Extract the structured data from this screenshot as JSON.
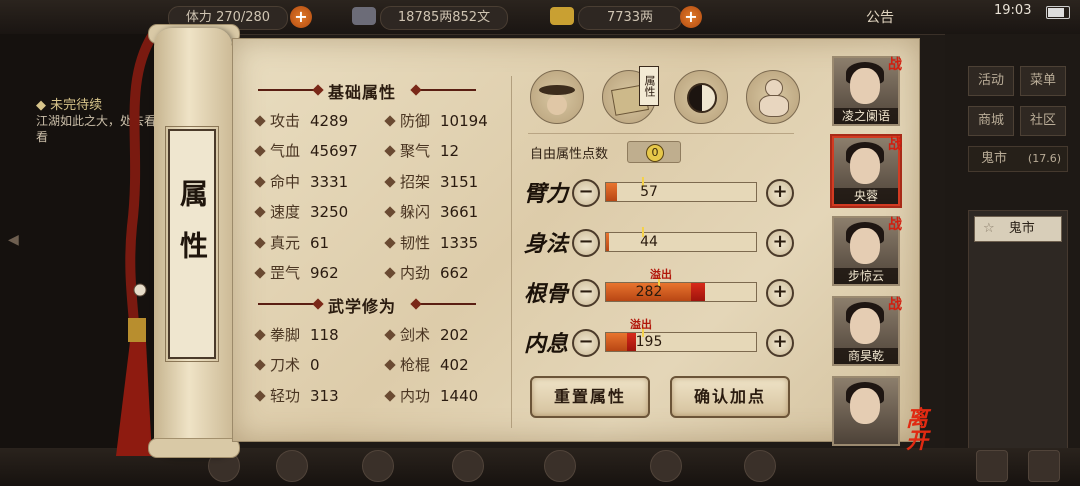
{
  "topbar": {
    "stamina_label": "体力",
    "stamina": "270/280",
    "silver": "18785两852文",
    "gold": "7733两",
    "announcement": "公告",
    "time": "19:03"
  },
  "quest": {
    "title": "未完待续",
    "desc": "江湖如此之大，处去看看"
  },
  "right_menu": [
    "活动",
    "菜单",
    "商城",
    "社区"
  ],
  "right_location": {
    "name": "鬼市",
    "level": "(17.6)"
  },
  "right_search": "鬼市",
  "scroll_title": "属性",
  "base_section": "基础属性",
  "base_stats": [
    {
      "name": "攻击",
      "value": "4289"
    },
    {
      "name": "防御",
      "value": "10194"
    },
    {
      "name": "气血",
      "value": "45697"
    },
    {
      "name": "聚气",
      "value": "12"
    },
    {
      "name": "命中",
      "value": "3331"
    },
    {
      "name": "招架",
      "value": "3151"
    },
    {
      "name": "速度",
      "value": "3250"
    },
    {
      "name": "躲闪",
      "value": "3661"
    },
    {
      "name": "真元",
      "value": "61"
    },
    {
      "name": "韧性",
      "value": "1335"
    },
    {
      "name": "罡气",
      "value": "962"
    },
    {
      "name": "内劲",
      "value": "662"
    }
  ],
  "martial_section": "武学修为",
  "martial_stats": [
    {
      "name": "拳脚",
      "value": "118"
    },
    {
      "name": "剑术",
      "value": "202"
    },
    {
      "name": "刀术",
      "value": "0"
    },
    {
      "name": "枪棍",
      "value": "402"
    },
    {
      "name": "轻功",
      "value": "313"
    },
    {
      "name": "内功",
      "value": "1440"
    }
  ],
  "tabs": {
    "badge": "属性"
  },
  "free_points_label": "自由属性点数",
  "free_points": "0",
  "attributes": [
    {
      "label": "臂力",
      "value": "57",
      "fill": 0.07,
      "overflow": 0,
      "overflow_label": ""
    },
    {
      "label": "身法",
      "value": "44",
      "fill": 0.02,
      "overflow": 0,
      "overflow_label": ""
    },
    {
      "label": "根骨",
      "value": "282",
      "fill": 0.57,
      "overflow": 0.09,
      "overflow_label": "溢出"
    },
    {
      "label": "内息",
      "value": "195",
      "fill": 0.14,
      "overflow": 0.06,
      "overflow_label": "溢出"
    }
  ],
  "reset_button": "重置属性",
  "confirm_button": "确认加点",
  "party": [
    {
      "name": "凌之阑语",
      "war": "战",
      "selected": false
    },
    {
      "name": "央蓉",
      "war": "战",
      "selected": true
    },
    {
      "name": "步惊云",
      "war": "战",
      "selected": false
    },
    {
      "name": "商昊乾",
      "war": "战",
      "selected": false
    },
    {
      "name": "",
      "war": "",
      "selected": false
    }
  ],
  "leave": "离开",
  "colors": {
    "accent": "#d23b22",
    "bar_fill": "#e8742e",
    "overflow": "#d82a1a",
    "parchment": "#e4d6b8"
  }
}
